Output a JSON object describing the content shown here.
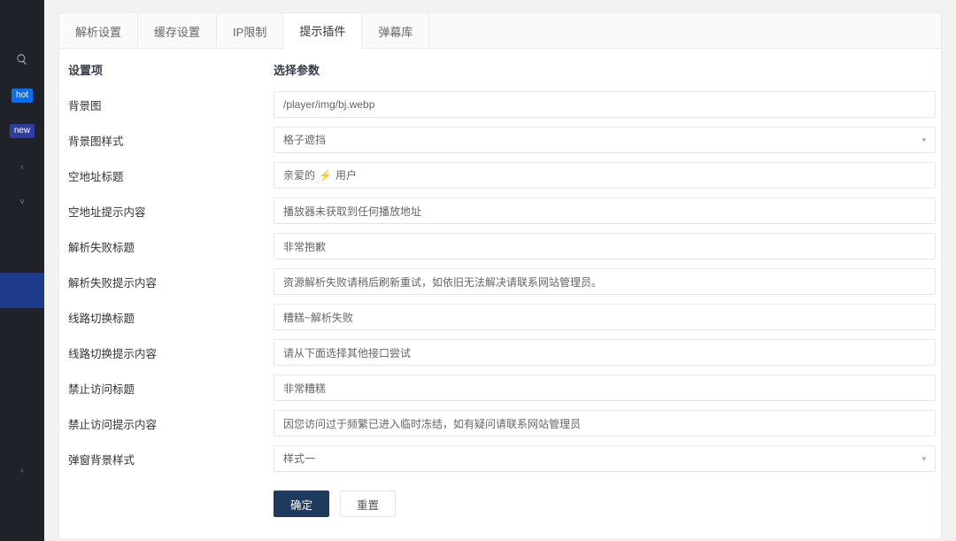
{
  "sidebar": {
    "search_icon": "search-icon",
    "badge_hot": "hot",
    "badge_new": "new",
    "arrow_left_1": "‹",
    "arrow_down": "˅",
    "arrow_left_2": "‹"
  },
  "tabs": [
    {
      "label": "解析设置"
    },
    {
      "label": "缓存设置"
    },
    {
      "label": "IP限制"
    },
    {
      "label": "提示插件",
      "active": true
    },
    {
      "label": "弹幕库"
    }
  ],
  "headers": {
    "setting_item": "设置项",
    "select_param": "选择参数"
  },
  "fields": {
    "bg_img": {
      "label": "背景图",
      "type": "text",
      "value": "/player/img/bj.webp"
    },
    "bg_style": {
      "label": "背景图样式",
      "type": "select",
      "value": "格子遮挡"
    },
    "empty_title": {
      "label": "空地址标题",
      "type": "text",
      "prefix": "亲爱的",
      "icon": "⚡",
      "suffix": "用户"
    },
    "empty_tip": {
      "label": "空地址提示内容",
      "type": "text",
      "value": "播放器未获取到任何播放地址"
    },
    "fail_title": {
      "label": "解析失败标题",
      "type": "text",
      "value": "非常抱歉"
    },
    "fail_tip": {
      "label": "解析失败提示内容",
      "type": "text",
      "value": "资源解析失败请稍后刷新重试，如依旧无法解决请联系网站管理员。"
    },
    "switch_title": {
      "label": "线路切换标题",
      "type": "text",
      "value": "糟糕~解析失败"
    },
    "switch_tip": {
      "label": "线路切换提示内容",
      "type": "text",
      "value": "请从下面选择其他接口尝试"
    },
    "deny_title": {
      "label": "禁止访问标题",
      "type": "text",
      "value": "非常糟糕"
    },
    "deny_tip": {
      "label": "禁止访问提示内容",
      "type": "text",
      "value": "因您访问过于频繁已进入临时冻结，如有疑问请联系网站管理员"
    },
    "popup_style": {
      "label": "弹窗背景样式",
      "type": "select",
      "value": "样式一"
    }
  },
  "buttons": {
    "submit": "确定",
    "reset": "重置"
  }
}
